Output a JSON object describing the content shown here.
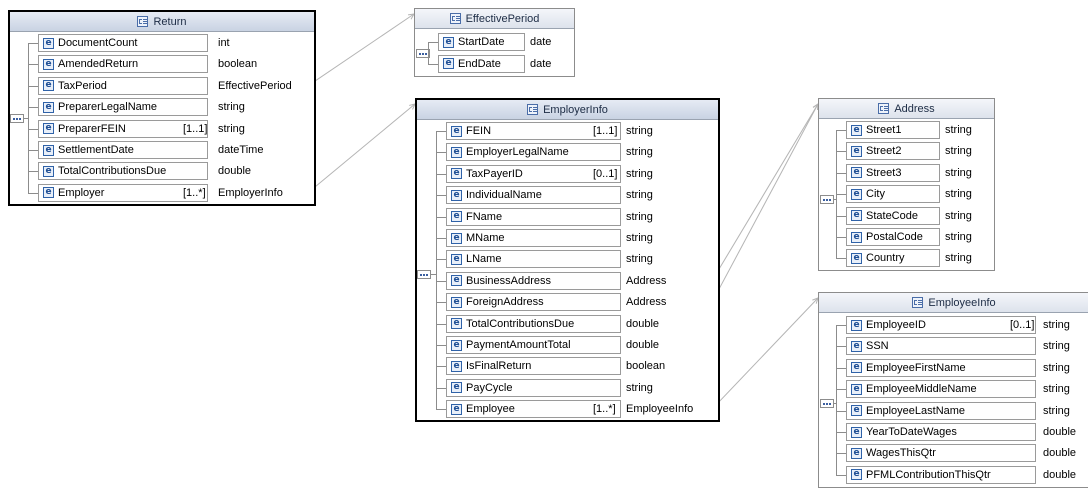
{
  "colors": {
    "border": "#8c8c8c",
    "header_bg": "#dde3ec",
    "element_icon": "#2f62a8",
    "connector": "#b4b4b4"
  },
  "element_icon_glyph": "e",
  "boxes": [
    {
      "id": "return",
      "title": "Return",
      "rows": [
        {
          "name": "DocumentCount",
          "card": "",
          "type": "int"
        },
        {
          "name": "AmendedReturn",
          "card": "",
          "type": "boolean"
        },
        {
          "name": "TaxPeriod",
          "card": "",
          "type": "EffectivePeriod"
        },
        {
          "name": "PreparerLegalName",
          "card": "",
          "type": "string"
        },
        {
          "name": "PreparerFEIN",
          "card": "[1..1]",
          "type": "string"
        },
        {
          "name": "SettlementDate",
          "card": "",
          "type": "dateTime"
        },
        {
          "name": "TotalContributionsDue",
          "card": "",
          "type": "double"
        },
        {
          "name": "Employer",
          "card": "[1..*]",
          "type": "EmployerInfo"
        }
      ]
    },
    {
      "id": "effectiveperiod",
      "title": "EffectivePeriod",
      "rows": [
        {
          "name": "StartDate",
          "card": "",
          "type": "date"
        },
        {
          "name": "EndDate",
          "card": "",
          "type": "date"
        }
      ]
    },
    {
      "id": "employerinfo",
      "title": "EmployerInfo",
      "rows": [
        {
          "name": "FEIN",
          "card": "[1..1]",
          "type": "string"
        },
        {
          "name": "EmployerLegalName",
          "card": "",
          "type": "string"
        },
        {
          "name": "TaxPayerID",
          "card": "[0..1]",
          "type": "string"
        },
        {
          "name": "IndividualName",
          "card": "",
          "type": "string"
        },
        {
          "name": "FName",
          "card": "",
          "type": "string"
        },
        {
          "name": "MName",
          "card": "",
          "type": "string"
        },
        {
          "name": "LName",
          "card": "",
          "type": "string"
        },
        {
          "name": "BusinessAddress",
          "card": "",
          "type": "Address"
        },
        {
          "name": "ForeignAddress",
          "card": "",
          "type": "Address"
        },
        {
          "name": "TotalContributionsDue",
          "card": "",
          "type": "double"
        },
        {
          "name": "PaymentAmountTotal",
          "card": "",
          "type": "double"
        },
        {
          "name": "IsFinalReturn",
          "card": "",
          "type": "boolean"
        },
        {
          "name": "PayCycle",
          "card": "",
          "type": "string"
        },
        {
          "name": "Employee",
          "card": "[1..*]",
          "type": "EmployeeInfo"
        }
      ]
    },
    {
      "id": "address",
      "title": "Address",
      "rows": [
        {
          "name": "Street1",
          "card": "",
          "type": "string"
        },
        {
          "name": "Street2",
          "card": "",
          "type": "string"
        },
        {
          "name": "Street3",
          "card": "",
          "type": "string"
        },
        {
          "name": "City",
          "card": "",
          "type": "string"
        },
        {
          "name": "StateCode",
          "card": "",
          "type": "string"
        },
        {
          "name": "PostalCode",
          "card": "",
          "type": "string"
        },
        {
          "name": "Country",
          "card": "",
          "type": "string"
        }
      ]
    },
    {
      "id": "employeeinfo",
      "title": "EmployeeInfo",
      "rows": [
        {
          "name": "EmployeeID",
          "card": "[0..1]",
          "type": "string"
        },
        {
          "name": "SSN",
          "card": "",
          "type": "string"
        },
        {
          "name": "EmployeeFirstName",
          "card": "",
          "type": "string"
        },
        {
          "name": "EmployeeMiddleName",
          "card": "",
          "type": "string"
        },
        {
          "name": "EmployeeLastName",
          "card": "",
          "type": "string"
        },
        {
          "name": "YearToDateWages",
          "card": "",
          "type": "double"
        },
        {
          "name": "WagesThisQtr",
          "card": "",
          "type": "double"
        },
        {
          "name": "PFMLContributionThisQtr",
          "card": "",
          "type": "double"
        }
      ]
    }
  ],
  "connections": [
    {
      "from_box": "return",
      "from_row": "TaxPeriod",
      "to_box": "effectiveperiod"
    },
    {
      "from_box": "return",
      "from_row": "Employer",
      "to_box": "employerinfo"
    },
    {
      "from_box": "employerinfo",
      "from_row": "BusinessAddress",
      "to_box": "address"
    },
    {
      "from_box": "employerinfo",
      "from_row": "ForeignAddress",
      "to_box": "address"
    },
    {
      "from_box": "employerinfo",
      "from_row": "Employee",
      "to_box": "employeeinfo"
    }
  ]
}
